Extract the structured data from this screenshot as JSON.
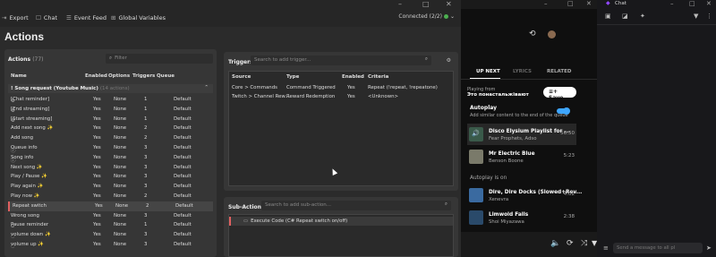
{
  "topbar": {
    "export": "Export",
    "chat": "Chat",
    "event_feed": "Event Feed",
    "global_vars": "Global Variables"
  },
  "connection": {
    "label": "Connected (2/2)",
    "status_color": "#4caf50"
  },
  "page_title": "Actions",
  "actions_panel": {
    "title": "Actions",
    "count": "(77)",
    "filter_placeholder": "Filter",
    "columns": [
      "Name",
      "Enabled",
      "Options",
      "Triggers",
      "Queue"
    ],
    "group": {
      "name": "! Song request (Youtube Music)",
      "sub": "(14 actions)"
    },
    "rows": [
      {
        "icon": "robot",
        "name": "[Chat reminder]",
        "enabled": "Yes",
        "options": "None",
        "triggers": "1",
        "queue": "Default"
      },
      {
        "icon": "robot",
        "name": "[End streaming]",
        "enabled": "Yes",
        "options": "None",
        "triggers": "1",
        "queue": "Default"
      },
      {
        "icon": "robot",
        "name": "[Start streaming]",
        "enabled": "Yes",
        "options": "None",
        "triggers": "1",
        "queue": "Default"
      },
      {
        "icon": "",
        "name": "Add next song ✨",
        "enabled": "Yes",
        "options": "None",
        "triggers": "2",
        "queue": "Default"
      },
      {
        "icon": "",
        "name": "Add song",
        "enabled": "Yes",
        "options": "None",
        "triggers": "2",
        "queue": "Default"
      },
      {
        "icon": "info",
        "name": "Queue info",
        "enabled": "Yes",
        "options": "None",
        "triggers": "3",
        "queue": "Default"
      },
      {
        "icon": "info",
        "name": "Song info",
        "enabled": "Yes",
        "options": "None",
        "triggers": "3",
        "queue": "Default"
      },
      {
        "icon": "",
        "name": "Next song ✨",
        "enabled": "Yes",
        "options": "None",
        "triggers": "3",
        "queue": "Default"
      },
      {
        "icon": "",
        "name": "Play / Pause ✨",
        "enabled": "Yes",
        "options": "None",
        "triggers": "3",
        "queue": "Default"
      },
      {
        "icon": "",
        "name": "Play again ✨",
        "enabled": "Yes",
        "options": "None",
        "triggers": "3",
        "queue": "Default"
      },
      {
        "icon": "",
        "name": "Play now ✨",
        "enabled": "Yes",
        "options": "None",
        "triggers": "2",
        "queue": "Default"
      },
      {
        "icon": "",
        "name": "Repeat switch",
        "enabled": "Yes",
        "options": "None",
        "triggers": "2",
        "queue": "Default",
        "selected": true
      },
      {
        "icon": "",
        "name": "Wrong song",
        "enabled": "Yes",
        "options": "None",
        "triggers": "3",
        "queue": "Default"
      },
      {
        "icon": "clock",
        "name": "Pause reminder",
        "enabled": "Yes",
        "options": "None",
        "triggers": "1",
        "queue": "Default"
      },
      {
        "icon": "chat",
        "name": "volume down ✨",
        "enabled": "Yes",
        "options": "None",
        "triggers": "3",
        "queue": "Default"
      },
      {
        "icon": "chat",
        "name": "volume up ✨",
        "enabled": "Yes",
        "options": "None",
        "triggers": "3",
        "queue": "Default"
      }
    ]
  },
  "triggers_panel": {
    "title": "Triggers",
    "search_placeholder": "Search to add trigger...",
    "columns": [
      "Source",
      "Type",
      "Enabled",
      "Criteria"
    ],
    "rows": [
      {
        "source": "Core > Commands",
        "type": "Command Triggered",
        "enabled": "Yes",
        "criteria": "Repeat (!repeat, !repeatone)"
      },
      {
        "source": "Twitch > Channel Rew...",
        "type": "Reward Redemption",
        "enabled": "Yes",
        "criteria": "<Unknown>"
      }
    ]
  },
  "subactions_panel": {
    "title": "Sub-Actions",
    "search_placeholder": "Search to add sub-action...",
    "item": "Execute Code (C# Repeat switch on/off)"
  },
  "music": {
    "tabs": [
      "UP NEXT",
      "LYRICS",
      "RELATED"
    ],
    "playing_from_label": "Playing from",
    "playlist": "Это понастальжівают",
    "save_label": "Save",
    "autoplay_label": "Autoplay",
    "autoplay_desc": "Add similar content to the end of the queue",
    "autoplay_on_label": "Autoplay is on",
    "queue": [
      {
        "title": "Disco Elysium Playlist for ...",
        "artist": "Fear Prophets, Adso",
        "duration": "56:50",
        "thumb": "#3a5a4a",
        "active": true
      },
      {
        "title": "Mr Electric Blue",
        "artist": "Benson Boone",
        "duration": "5:23",
        "thumb": "#7a7a6a",
        "active": false
      }
    ],
    "autoplay_queue": [
      {
        "title": "Dire, Dire Docks (Slowed+Rev...",
        "artist": "Xenevra",
        "duration": "4:02",
        "thumb": "#3a6aa0"
      },
      {
        "title": "Limwold Falls",
        "artist": "Shoi Miyazawa",
        "duration": "2:38",
        "thumb": "#2a4a6a"
      }
    ]
  },
  "chat": {
    "title": "Chat",
    "input_placeholder": "Send a message to all pl"
  }
}
